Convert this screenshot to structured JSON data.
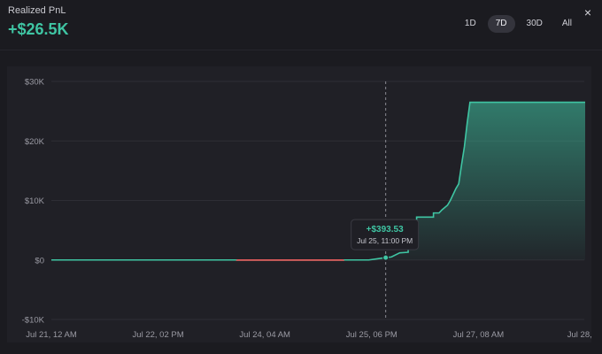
{
  "header": {
    "title": "Realized PnL",
    "value": "+$26.5K"
  },
  "ranges": [
    {
      "label": "1D",
      "active": false
    },
    {
      "label": "7D",
      "active": true
    },
    {
      "label": "30D",
      "active": false
    },
    {
      "label": "All",
      "active": false
    }
  ],
  "close_glyph": "×",
  "colors": {
    "positive": "#3fc5a3",
    "negative": "#e15b5b",
    "grid": "#2e2e35",
    "text": "#9a9aa3"
  },
  "tooltip": {
    "value": "+$393.53",
    "date": "Jul 25, 11:00 PM"
  },
  "chart_data": {
    "type": "area",
    "ylim": [
      -10000,
      30000
    ],
    "y_ticks": [
      {
        "value": 30000,
        "label": "$30K"
      },
      {
        "value": 20000,
        "label": "$20K"
      },
      {
        "value": 10000,
        "label": "$10K"
      },
      {
        "value": 0,
        "label": "$0"
      },
      {
        "value": -10000,
        "label": "-$10K"
      }
    ],
    "x_range_hours": [
      0,
      172
    ],
    "x_ticks": [
      {
        "hour": 0,
        "label": "Jul 21, 12 AM"
      },
      {
        "hour": 38,
        "label": "Jul 22, 02 PM"
      },
      {
        "hour": 76,
        "label": "Jul 24, 04 AM"
      },
      {
        "hour": 114,
        "label": "Jul 25, 06 PM"
      },
      {
        "hour": 152,
        "label": "Jul 27, 08 AM"
      },
      {
        "hour": 190,
        "label": "Jul 28, 11"
      }
    ],
    "cursor_hour": 119,
    "series": [
      {
        "values": [
          [
            0,
            0
          ],
          [
            66,
            0
          ],
          [
            66,
            -20
          ],
          [
            104,
            -20
          ],
          [
            104,
            0
          ],
          [
            113,
            0
          ],
          [
            116,
            200
          ],
          [
            119,
            393.53
          ],
          [
            121,
            500
          ],
          [
            124,
            1200
          ],
          [
            127,
            1300
          ],
          [
            127,
            6500
          ],
          [
            130,
            6500
          ],
          [
            130,
            7200
          ],
          [
            136,
            7200
          ],
          [
            136,
            7900
          ],
          [
            138,
            7900
          ],
          [
            139,
            8400
          ],
          [
            141,
            9200
          ],
          [
            142,
            10000
          ],
          [
            144,
            12000
          ],
          [
            145,
            12800
          ],
          [
            146,
            16000
          ],
          [
            147,
            19000
          ],
          [
            148,
            23000
          ],
          [
            149,
            26500
          ],
          [
            190,
            26500
          ]
        ],
        "negative_segment": [
          66,
          104
        ]
      }
    ]
  }
}
